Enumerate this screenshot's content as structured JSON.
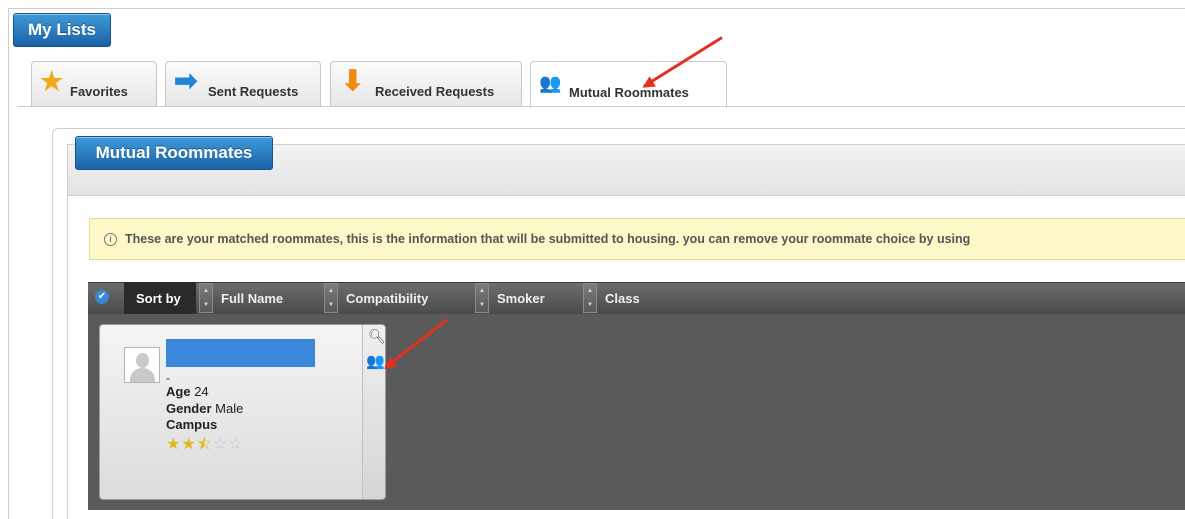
{
  "header": {
    "title": "My Lists"
  },
  "tabs": [
    {
      "label": "Favorites",
      "icon": "star-icon"
    },
    {
      "label": "Sent Requests",
      "icon": "arrow-right-icon"
    },
    {
      "label": "Received Requests",
      "icon": "arrow-down-icon"
    },
    {
      "label": "Mutual Roommates",
      "icon": "people-icon",
      "active": true
    }
  ],
  "section": {
    "title": "Mutual Roommates"
  },
  "notice": {
    "icon": "info-icon",
    "text": "These are your matched roommates, this is the information that will be submitted to housing. you can remove your roommate choice by using"
  },
  "sortbar": {
    "sort_label": "Sort by",
    "fields": [
      "Full Name",
      "Compatibility",
      "Smoker",
      "Class"
    ]
  },
  "card": {
    "dash": "-",
    "age_label": "Age",
    "age_value": "24",
    "gender_label": "Gender",
    "gender_value": "Male",
    "campus_label": "Campus",
    "campus_value": "",
    "rating": 2.5,
    "rating_max": 5
  },
  "colors": {
    "accent": "#1a62a6",
    "notice_bg": "#fcf8c8",
    "results_bg": "#5a5a5a",
    "annotation": "#e3301e"
  }
}
